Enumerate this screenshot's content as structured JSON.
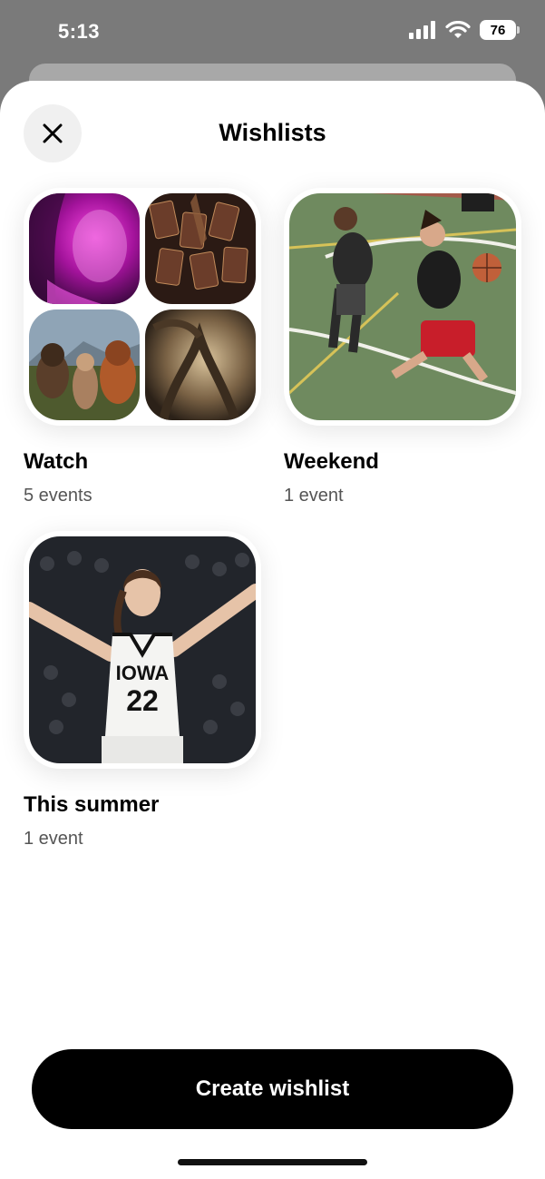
{
  "status": {
    "time": "5:13",
    "battery": "76"
  },
  "header": {
    "title": "Wishlists",
    "close_icon": "close-icon"
  },
  "wishlists": [
    {
      "name": "Watch",
      "count": "5 events"
    },
    {
      "name": "Weekend",
      "count": "1 event"
    },
    {
      "name": "This summer",
      "count": "1 event",
      "jersey_team": "IOWA",
      "jersey_number": "22"
    }
  ],
  "footer": {
    "create_label": "Create wishlist"
  },
  "colors": {
    "accent": "#000000",
    "sheet": "#ffffff",
    "backdrop": "#7a7a7a"
  }
}
